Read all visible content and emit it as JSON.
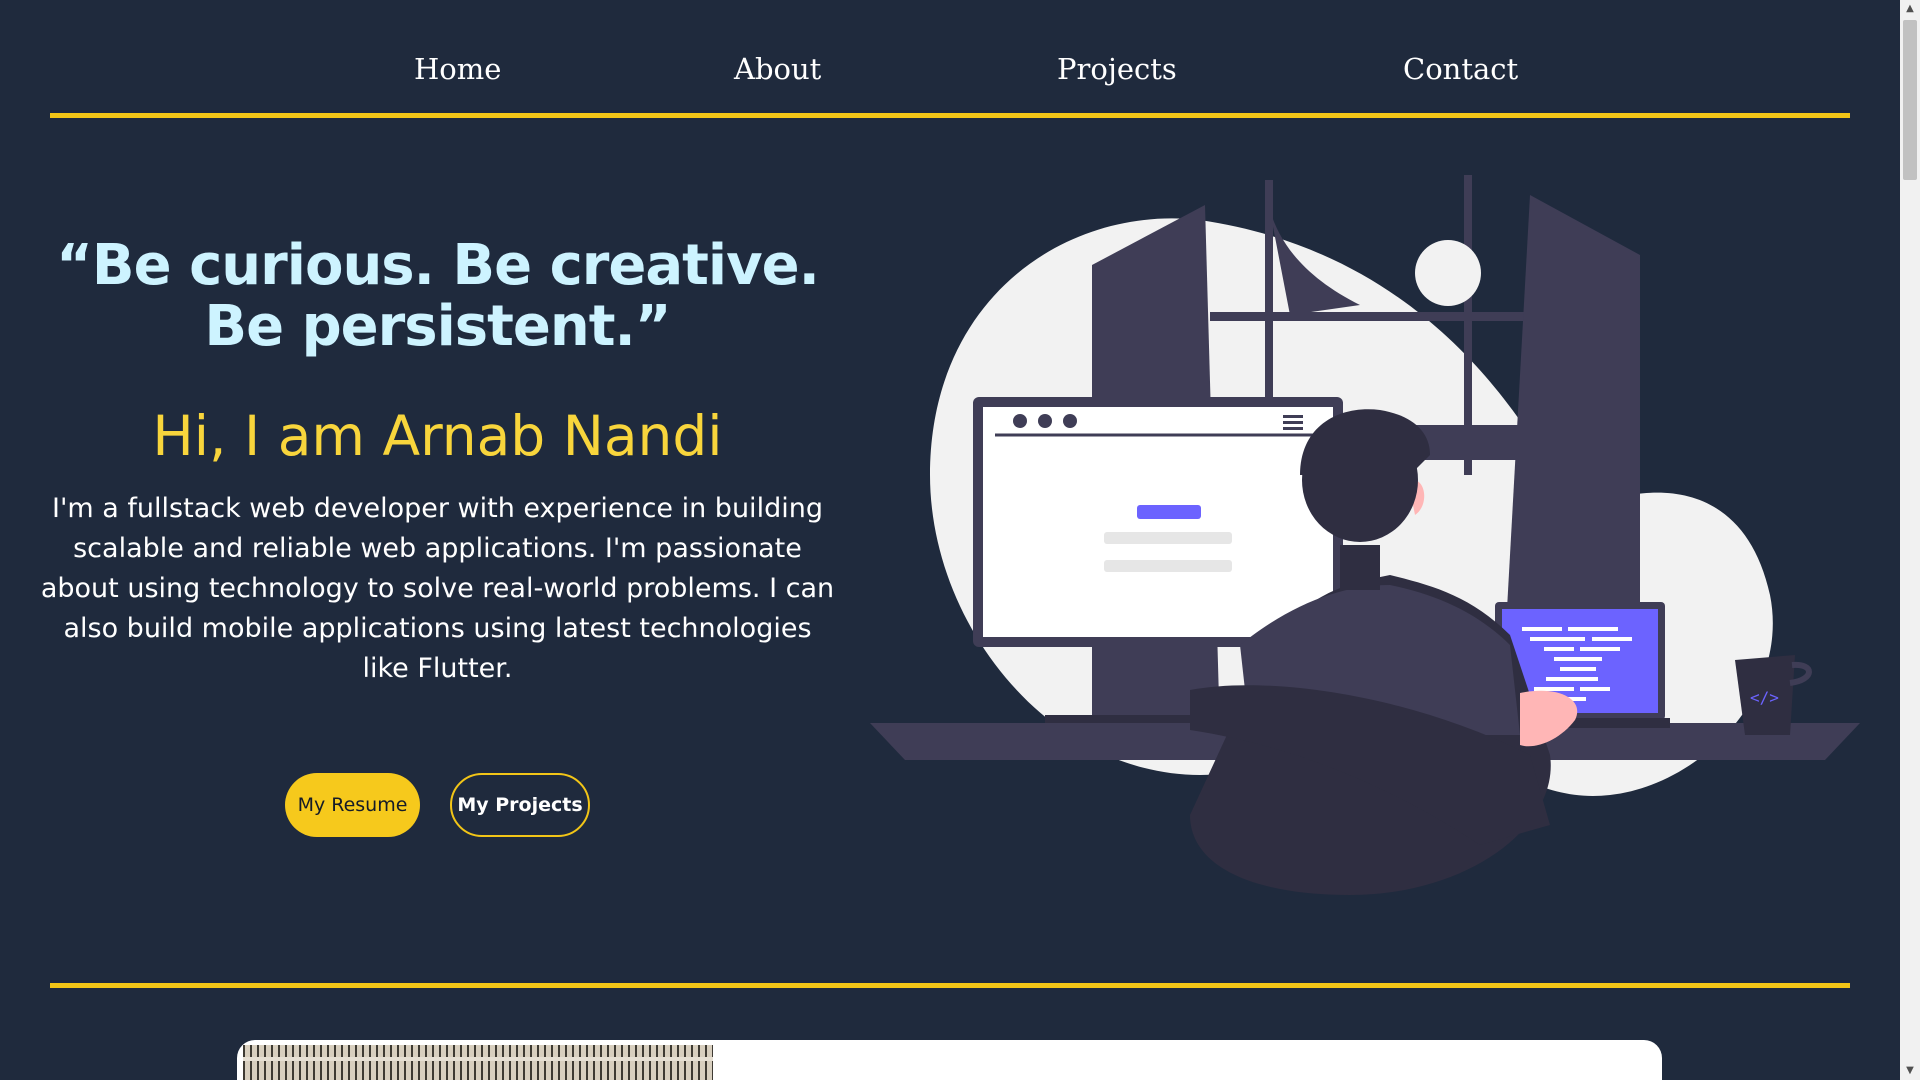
{
  "nav": {
    "items": [
      {
        "label": "Home"
      },
      {
        "label": "About"
      },
      {
        "label": "Projects"
      },
      {
        "label": "Contact"
      }
    ]
  },
  "hero": {
    "quote": "“Be curious. Be creative. Be persistent.”",
    "greeting": "Hi, I am Arnab Nandi",
    "intro": "I'm a fullstack web developer with experience in building scalable and reliable web applications. I'm passionate about using technology to solve real-world problems. I can also build mobile applications using latest technologies like Flutter.",
    "buttons": {
      "resume_label": "My Resume",
      "projects_label": "My Projects"
    }
  },
  "colors": {
    "background": "#1f2a3d",
    "accent": "#f2c517",
    "quote_text": "#cdf3ff",
    "greeting_text": "#f8d53c"
  },
  "illustration": {
    "icon": "developer-at-desk-illustration",
    "mug_glyph": "</>"
  }
}
